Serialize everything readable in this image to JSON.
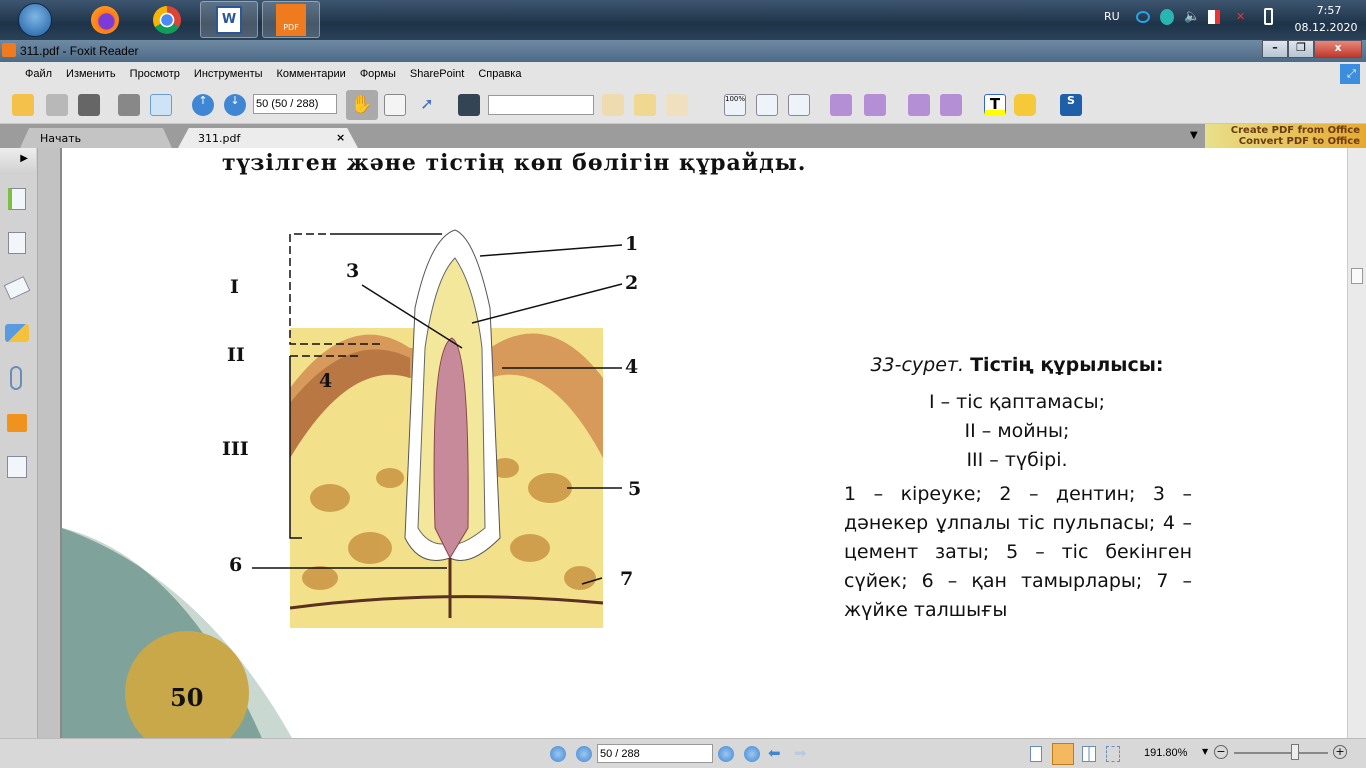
{
  "taskbar": {
    "apps": [
      "start",
      "firefox",
      "chrome",
      "word",
      "foxit-pdf"
    ],
    "tray": {
      "language": "RU",
      "time": "7:57",
      "date": "08.12.2020"
    },
    "pdf_icon_label": "PDF"
  },
  "window": {
    "title": "311.pdf - Foxit Reader"
  },
  "menu": [
    "Файл",
    "Изменить",
    "Просмотр",
    "Инструменты",
    "Комментарии",
    "Формы",
    "SharePoint",
    "Справка"
  ],
  "toolbar": {
    "page_field": "50 (50 / 288)",
    "search_value": ""
  },
  "tabs": [
    {
      "label": "Начать"
    },
    {
      "label": "311.pdf"
    }
  ],
  "promo": {
    "line1": "Create PDF from Office",
    "line2": "Convert PDF to Office"
  },
  "document": {
    "heading": "түзілген және тістің көп бөлігін құрайды.",
    "figure_labels": {
      "I": "I",
      "II": "II",
      "III": "III",
      "n1": "1",
      "n2": "2",
      "n3": "3",
      "n4a": "4",
      "n4b": "4",
      "n5": "5",
      "n6": "6",
      "n7": "7"
    },
    "caption_italic": "33-сурет.",
    "caption_bold": "Тістің құрылысы:",
    "parts": [
      "I – тіс қаптамасы;",
      "II – мойны;",
      "III – түбірі."
    ],
    "legend": "1 – кіреуке; 2 – дентин; 3 – дәнекер ұлпалы тіс пульпасы; 4 – цемент заты; 5 – тіс бекінген сүйек; 6 – қан тамырлары; 7 – жүйке талшығы",
    "page_number": "50"
  },
  "statusbar": {
    "page_field": "50 / 288",
    "zoom": "191.80%",
    "zoom_slider_fraction": 0.65
  }
}
